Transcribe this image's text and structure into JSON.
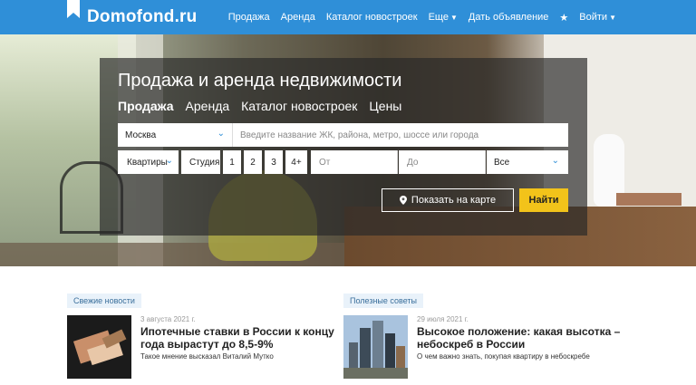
{
  "header": {
    "logo_text": "Domofond.ru",
    "nav": {
      "sale": "Продажа",
      "rent": "Аренда",
      "catalog": "Каталог новостроек",
      "more": "Еще",
      "post_ad": "Дать объявление",
      "login": "Войти"
    }
  },
  "search": {
    "title": "Продажа и аренда недвижимости",
    "tabs": [
      "Продажа",
      "Аренда",
      "Каталог новостроек",
      "Цены"
    ],
    "active_tab": "Продажа",
    "city": "Москва",
    "query_placeholder": "Введите название ЖК, района, метро, шоссе или города",
    "rooms": "Квартиры",
    "studio": "Студия",
    "room_counts": [
      "1",
      "2",
      "3",
      "4+"
    ],
    "price_from_placeholder": "От",
    "price_to_placeholder": "До",
    "currency": "Все",
    "map_button": "Показать на карте",
    "find_button": "Найти"
  },
  "news": [
    {
      "tag": "Свежие новости",
      "date": "3 августа 2021 г.",
      "title": "Ипотечные ставки в России к концу года вырастут до 8,5-9%",
      "subtitle": "Такое мнение высказал Виталий Мутко"
    },
    {
      "tag": "Полезные советы",
      "date": "29 июля 2021 г.",
      "title": "Высокое положение: какая высотка – небоскреб в России",
      "subtitle": "О чем важно знать, покупая квартиру в небоскребе"
    }
  ],
  "colors": {
    "brand_blue": "#2f8fd8",
    "accent_yellow": "#f2c31a",
    "overlay": "rgba(40,40,40,0.68)"
  },
  "icons": [
    "logo-flag-icon",
    "chevron-down-icon",
    "star-icon",
    "map-pin-icon"
  ]
}
